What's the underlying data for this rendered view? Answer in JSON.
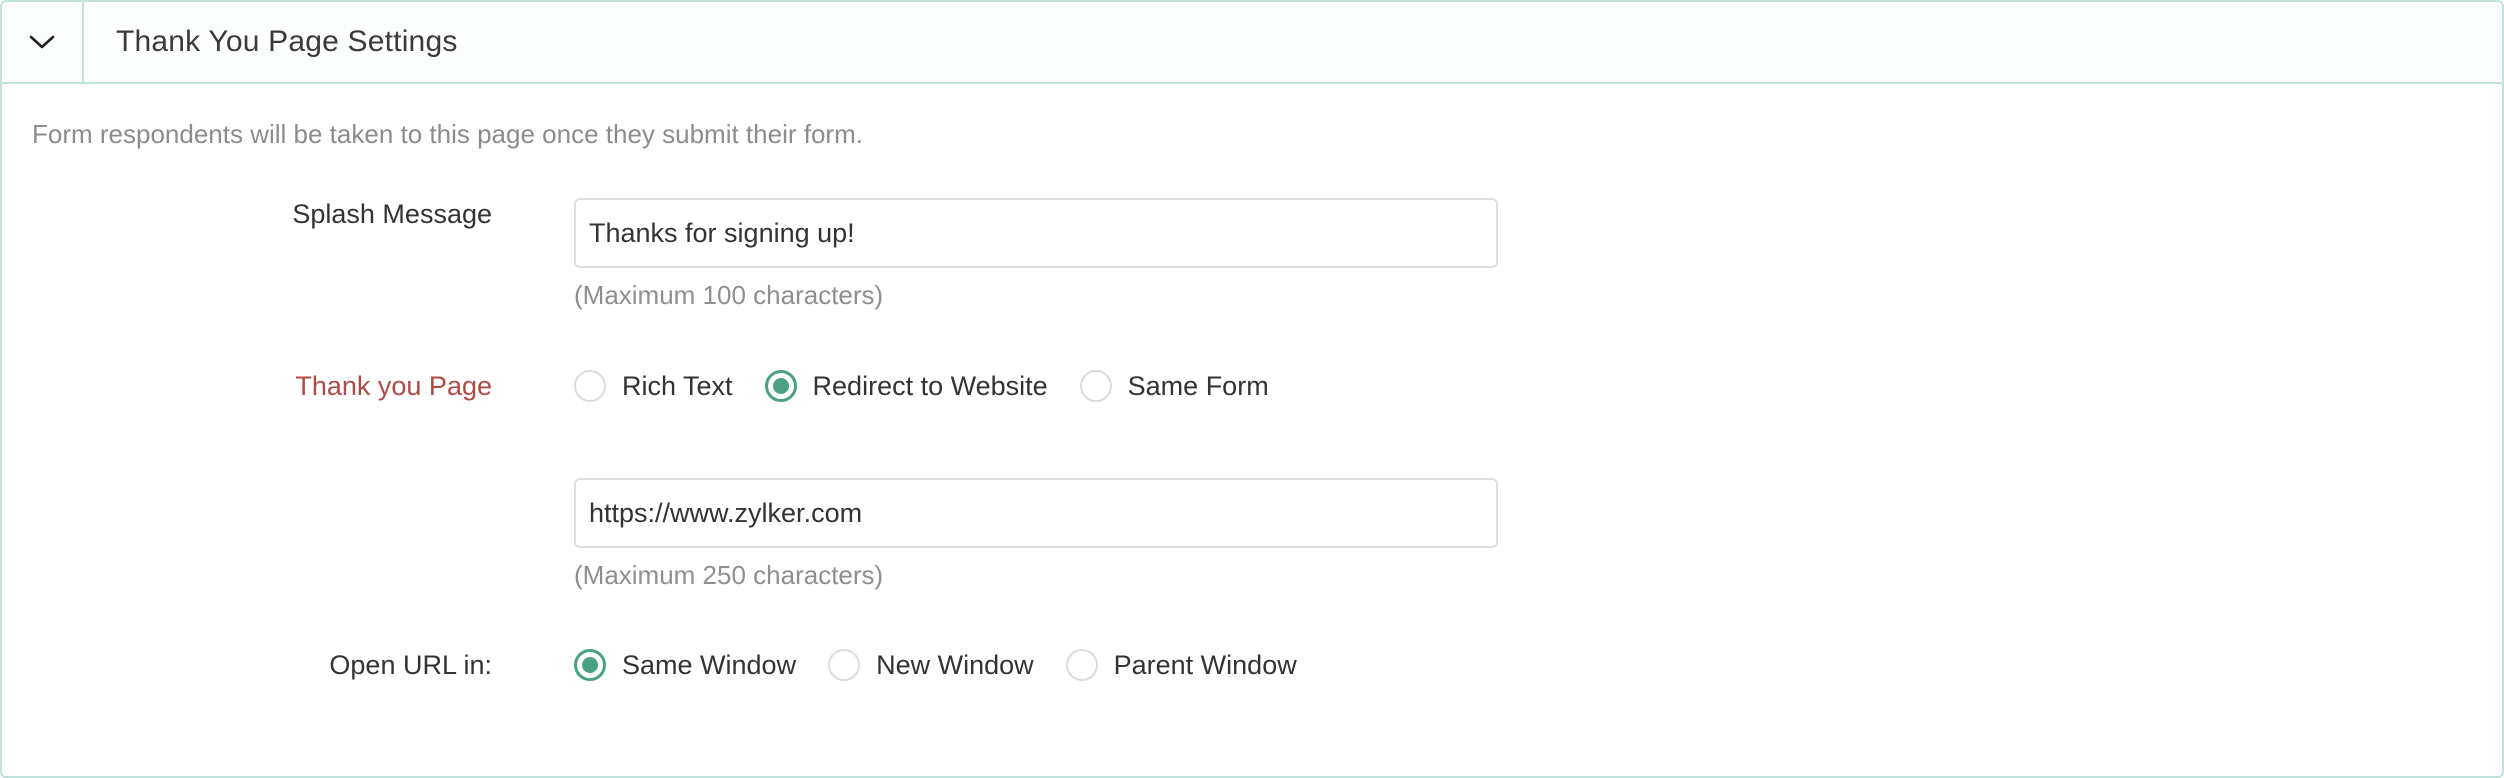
{
  "section": {
    "title": "Thank You Page Settings",
    "toggle_icon": "chevron-down-icon",
    "description": "Form respondents will be taken to this page once they submit their form."
  },
  "splash": {
    "label": "Splash Message",
    "value": "Thanks for signing up!",
    "hint": "(Maximum 100 characters)"
  },
  "thank_you_page": {
    "label": "Thank you Page",
    "required_color": "#b04a47",
    "options": [
      {
        "label": "Rich Text",
        "checked": false
      },
      {
        "label": "Redirect to Website",
        "checked": true
      },
      {
        "label": "Same Form",
        "checked": false
      }
    ]
  },
  "redirect_url": {
    "value": "https://www.zylker.com",
    "hint": "(Maximum 250 characters)"
  },
  "open_url": {
    "label": "Open URL in:",
    "options": [
      {
        "label": "Same Window",
        "checked": true
      },
      {
        "label": "New Window",
        "checked": false
      },
      {
        "label": "Parent Window",
        "checked": false
      }
    ]
  },
  "colors": {
    "accent": "#4ba085",
    "border": "#c1e3dc"
  }
}
